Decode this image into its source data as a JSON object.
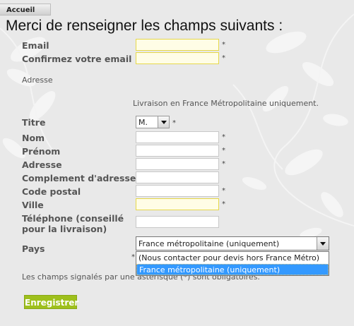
{
  "breadcrumb": {
    "home": "Accueil"
  },
  "heading": "Merci de renseigner les champs suivants :",
  "required_mark": "*",
  "fields": {
    "email": "Email",
    "email_confirm": "Confirmez votre email",
    "address_section": "Adresse",
    "delivery_note": "Livraison en France Métropolitaine uniquement.",
    "title": "Titre",
    "title_value": "M.",
    "lastname": "Nom",
    "firstname": "Prénom",
    "address": "Adresse",
    "address2": "Complement d'adresse",
    "postcode": "Code postal",
    "city": "Ville",
    "phone": "Téléphone (conseillé pour la livraison)",
    "country": "Pays",
    "country_value": "France métropolitaine (uniquement)"
  },
  "country_options": [
    "(Nous contacter pour devis hors France Métro)",
    "France métropolitaine (uniquement)"
  ],
  "required_note": "Les champs signalés par une astérisque (*) sont obligatoires.",
  "submit_label": "Enregistrer"
}
